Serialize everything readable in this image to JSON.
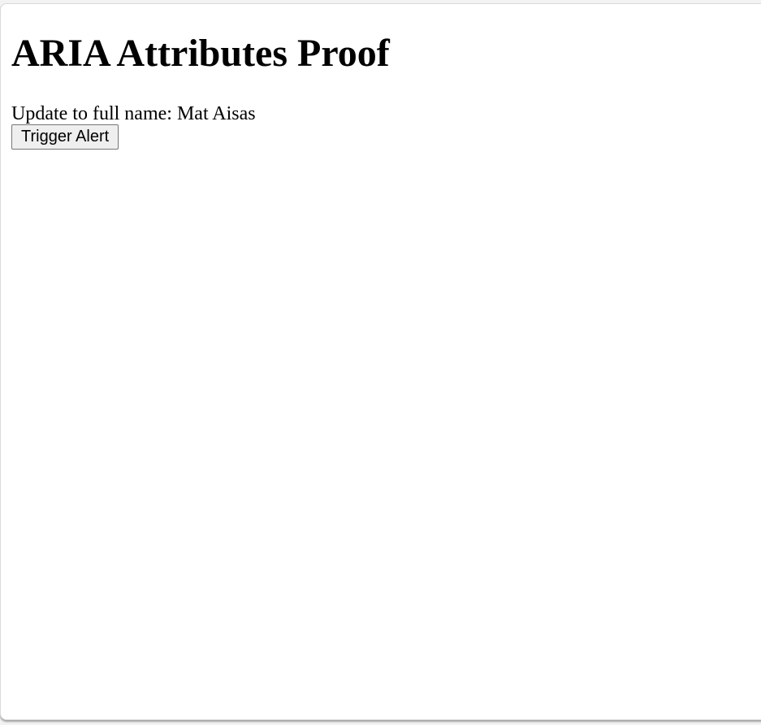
{
  "page": {
    "heading": "ARIA Attributes Proof",
    "status_prefix": "Update to full name: ",
    "status_value": "Mat Aisas",
    "alert_button_label": "Trigger Alert"
  }
}
